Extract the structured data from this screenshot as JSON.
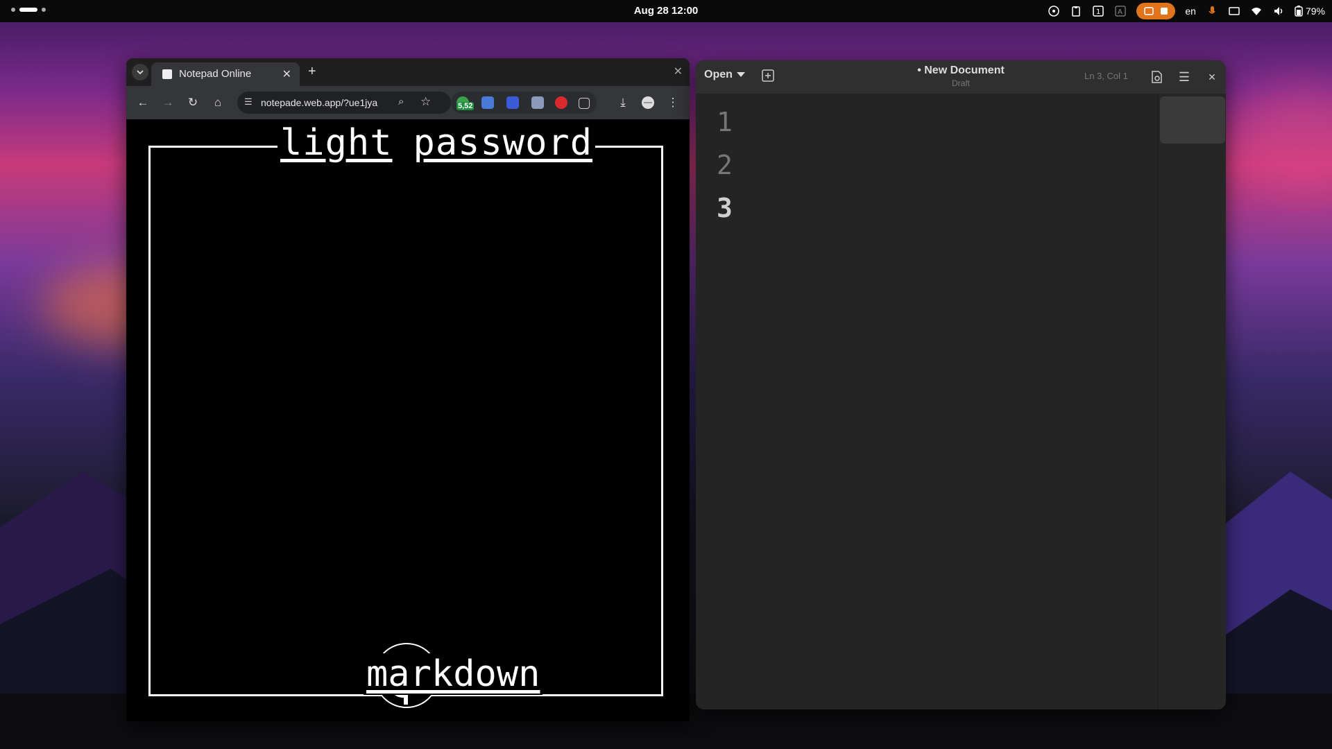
{
  "topbar": {
    "clock": "Aug 28  12:00",
    "language": "en",
    "battery": "79%"
  },
  "browser": {
    "tab_title": "Notepad Online",
    "url": "notepade.web.app/?ue1jya",
    "extension_badge": "5,52",
    "page": {
      "title_word1": "light",
      "title_word2": "password",
      "bottom_label": "markdown"
    }
  },
  "editor": {
    "open_label": "Open",
    "doc_title": "• New Document",
    "doc_subtitle": "Draft",
    "cursor_position": "Ln 3, Col 1",
    "line_numbers": [
      "1",
      "2",
      "3"
    ]
  },
  "icons": {
    "tab_favicon": "notepad-icon",
    "back": "back-arrow-icon",
    "forward": "forward-arrow-icon",
    "reload": "reload-icon",
    "home": "home-icon",
    "download": "download-icon",
    "menu": "kebab-menu-icon"
  },
  "colors": {
    "accent_recording": "#e0741c",
    "badge_green": "#1e8e3e"
  }
}
